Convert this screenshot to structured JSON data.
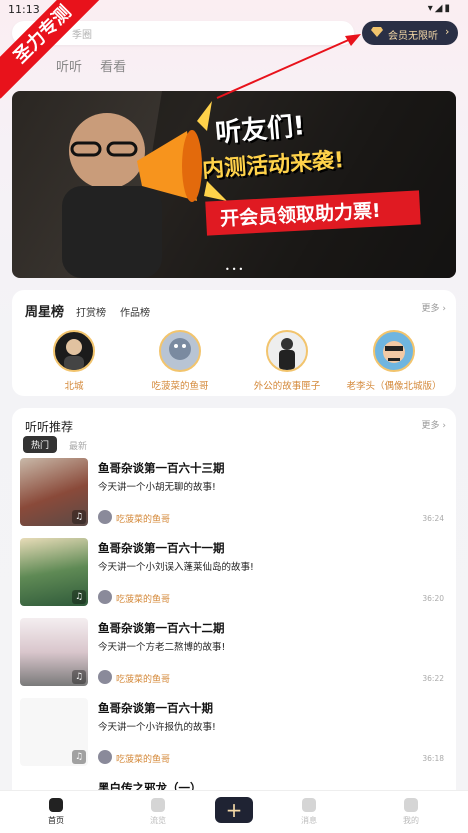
{
  "status_bar": {
    "time": "11:13",
    "icons": "▾◢▮"
  },
  "ribbon": "圣力专测",
  "search": {
    "placeholder": "季圈"
  },
  "vip_button": {
    "label": "会员无限听",
    "chevron": "›"
  },
  "top_nav": [
    "听听",
    "看看"
  ],
  "banner": {
    "line1": "听友们!",
    "line2": "内测活动来袭!",
    "line3": "开会员领取助力票!",
    "dots": "•••"
  },
  "weekly": {
    "title": "周星榜",
    "tabs": [
      "打赏榜",
      "作品榜"
    ],
    "more": "更多 ›",
    "ranks": [
      {
        "name": "北城"
      },
      {
        "name": "吃菠菜的鱼哥"
      },
      {
        "name": "外公的故事匣子"
      },
      {
        "name": "老李头（偶像北城版）"
      }
    ]
  },
  "recommend": {
    "title": "听听推荐",
    "more": "更多 ›",
    "tabs": [
      "热门",
      "最新"
    ],
    "items": [
      {
        "title": "鱼哥杂谈第一百六十三期",
        "desc": "今天讲一个小胡无聊的故事!",
        "author": "吃菠菜的鱼哥",
        "duration": "36:24"
      },
      {
        "title": "鱼哥杂谈第一百六十一期",
        "desc": "今天讲一个小刘误入蓬莱仙岛的故事!",
        "author": "吃菠菜的鱼哥",
        "duration": "36:20"
      },
      {
        "title": "鱼哥杂谈第一百六十二期",
        "desc": "今天讲一个方老二熬博的故事!",
        "author": "吃菠菜的鱼哥",
        "duration": "36:22"
      },
      {
        "title": "鱼哥杂谈第一百六十期",
        "desc": "今天讲一个小许报仇的故事!",
        "author": "吃菠菜的鱼哥",
        "duration": "36:18"
      },
      {
        "title": "黑白传之邪龙（一）"
      }
    ]
  },
  "bottom_nav": [
    {
      "label": "首页"
    },
    {
      "label": "流览"
    },
    {
      "label": "+"
    },
    {
      "label": "消息"
    },
    {
      "label": "我的"
    }
  ],
  "colors": {
    "accent": "#d4893a",
    "vip_bg": "#2a2f45",
    "ribbon": "#e8121b"
  }
}
